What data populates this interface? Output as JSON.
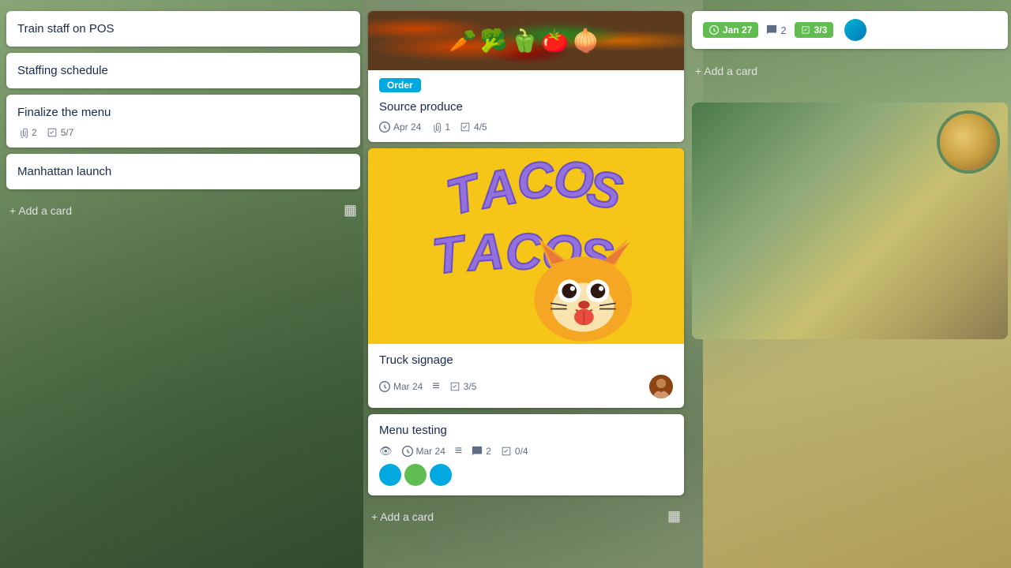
{
  "board": {
    "background": "food-theme"
  },
  "leftColumn": {
    "cards": [
      {
        "id": "card-pos",
        "title": "Train staff on POS",
        "meta": []
      },
      {
        "id": "card-staffing",
        "title": "Staffing schedule",
        "meta": []
      },
      {
        "id": "card-menu",
        "title": "Finalize the menu",
        "attachments": "2",
        "checklist": "5/7"
      },
      {
        "id": "card-launch",
        "title": "Manhattan launch",
        "meta": []
      }
    ],
    "addCardLabel": "+ Add a card"
  },
  "middleColumn": {
    "cards": [
      {
        "id": "card-produce",
        "label": "Order",
        "labelColor": "#00a8e0",
        "title": "Source produce",
        "date": "Apr 24",
        "attachments": "1",
        "checklist": "4/5"
      },
      {
        "id": "card-taco",
        "title": "Truck signage",
        "date": "Mar 24",
        "checklist": "3/5",
        "hasDescription": true
      },
      {
        "id": "card-menu-testing",
        "title": "Menu testing",
        "date": "Mar 24",
        "comments": "2",
        "checklist": "0/4",
        "hasWatch": true,
        "hasDescription": true
      }
    ],
    "addCardLabel": "+ Add a card"
  },
  "rightColumn": {
    "topCard": {
      "date": "Jan 27",
      "comments": "2",
      "checklist": "3/3"
    },
    "addCardLabel": "+ Add a card"
  },
  "icons": {
    "clock": "🕐",
    "paperclip": "📎",
    "checklist": "✓",
    "comment": "💬",
    "description": "≡",
    "eye": "👁",
    "template": "▦"
  }
}
